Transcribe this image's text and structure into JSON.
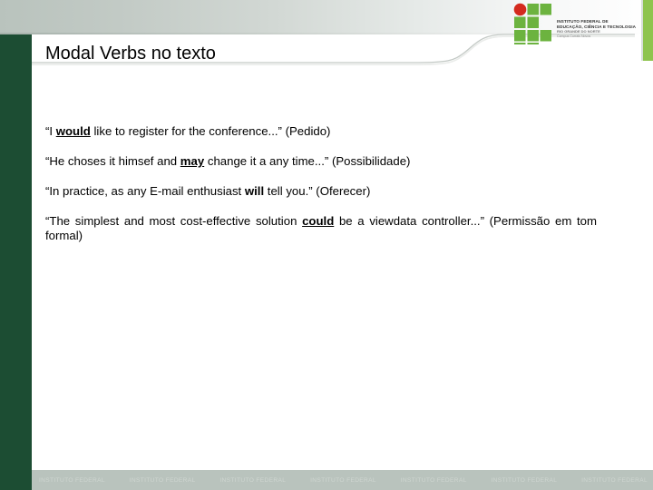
{
  "slide": {
    "title": "Modal Verbs no texto",
    "background_color": "#ffffff",
    "sidebar_color": "#1c4d33",
    "accent_green": "#8ec44e",
    "footer_band_color": "#b9c3bd"
  },
  "logo": {
    "name": "ifrn-logo",
    "line1": "INSTITUTO FEDERAL DE",
    "line2": "EDUCAÇÃO, CIÊNCIA E TECNOLOGIA",
    "line3": "RIO GRANDE DO NORTE",
    "line4": "Campus Currais Novos",
    "square_color": "#6cb33f",
    "circle_color": "#d42a1e"
  },
  "body": {
    "paragraphs": [
      {
        "id": "p1",
        "segments": [
          {
            "text": "“I ",
            "style": "normal"
          },
          {
            "text": "would",
            "style": "bold-underline"
          },
          {
            "text": " like to register for the conference...” (Pedido)",
            "style": "normal"
          }
        ]
      },
      {
        "id": "p2",
        "segments": [
          {
            "text": "“He choses it himsef and ",
            "style": "normal"
          },
          {
            "text": "may",
            "style": "bold-underline"
          },
          {
            "text": " change it a any time...” (Possibilidade)",
            "style": "normal"
          }
        ]
      },
      {
        "id": "p3",
        "segments": [
          {
            "text": "“In practice, as any E-mail enthusiast ",
            "style": "normal"
          },
          {
            "text": "will",
            "style": "bold"
          },
          {
            "text": " tell you.” (Oferecer)",
            "style": "normal"
          }
        ]
      },
      {
        "id": "p4",
        "segments": [
          {
            "text": "“The simplest and most cost-effective solution ",
            "style": "normal"
          },
          {
            "text": "could",
            "style": "bold-underline"
          },
          {
            "text": " be a viewdata controller...” (Permissão em tom formal)",
            "style": "normal"
          }
        ]
      }
    ]
  },
  "footer": {
    "watermarks": [
      "INSTITUTO FEDERAL",
      "INSTITUTO FEDERAL",
      "INSTITUTO FEDERAL",
      "INSTITUTO FEDERAL",
      "INSTITUTO FEDERAL",
      "INSTITUTO FEDERAL",
      "INSTITUTO FEDERAL"
    ]
  }
}
